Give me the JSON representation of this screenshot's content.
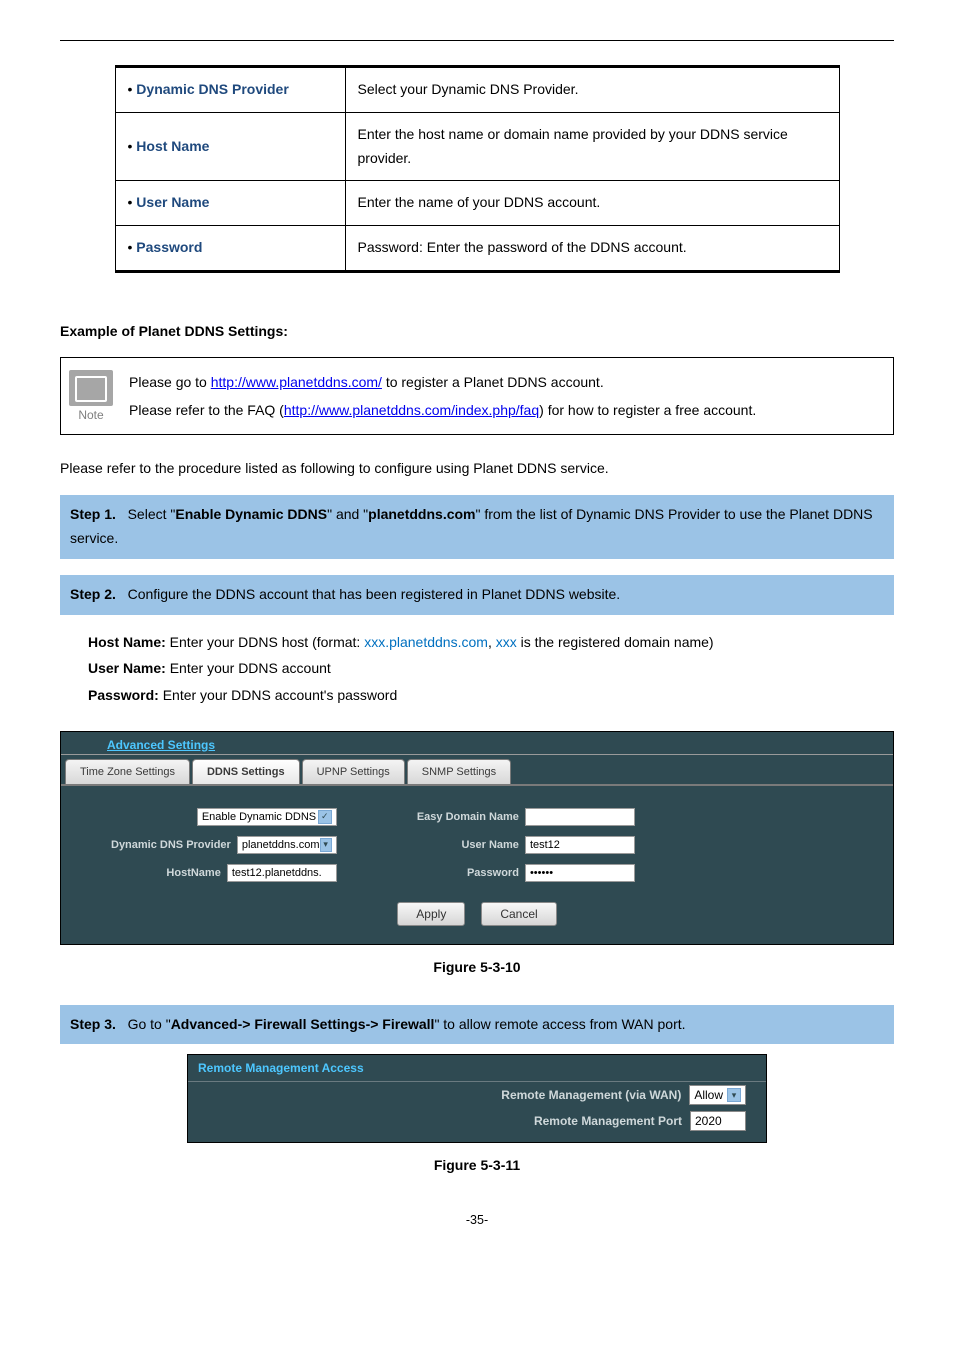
{
  "table": {
    "rows": [
      {
        "label": "Dynamic DNS Provider",
        "desc": "Select your Dynamic DNS Provider."
      },
      {
        "label": "Host Name",
        "desc": "Enter the host name or domain name provided by your DDNS service provider."
      },
      {
        "label": "User Name",
        "desc": "Enter the name of your DDNS account."
      },
      {
        "label": "Password",
        "desc": "Password: Enter the password of the DDNS account."
      }
    ]
  },
  "exampleHeading": "Example of Planet DDNS Settings:",
  "note": {
    "label": "Note",
    "line1_pre": "Please go to ",
    "link1": "http://www.planetddns.com/",
    "line1_post": " to register a Planet DDNS account.",
    "line2_pre": "Please refer to the FAQ (",
    "link2": "http://www.planetddns.com/index.php/faq",
    "line2_post": ") for how to register a free account."
  },
  "intro": "Please refer to the procedure listed as following to configure using Planet DDNS service.",
  "step1": {
    "label": "Step 1.",
    "t1": "Select \"",
    "s1": "Enable Dynamic DDNS",
    "t2": "\" and \"",
    "s2": "planetddns.com",
    "t3": "\" from the list of Dynamic DNS Provider to use the Planet DDNS service."
  },
  "step2": {
    "label": "Step 2.",
    "text": "Configure the DDNS account that has been registered in Planet DDNS website.",
    "body": {
      "hn_label": "Host Name:",
      "hn_text_pre": " Enter your DDNS host (format: ",
      "hn_fmt1": "xxx.planetddns.com",
      "hn_comma": ", ",
      "hn_fmt2": "xxx",
      "hn_text_post": " is the registered domain name)",
      "un_label": "User Name:",
      "un_text": " Enter your DDNS account",
      "pw_label": "Password:",
      "pw_text": " Enter your DDNS account's password"
    }
  },
  "ui1": {
    "header": "Advanced Settings",
    "tabs": [
      "Time Zone Settings",
      "DDNS Settings",
      "UPNP Settings",
      "SNMP Settings"
    ],
    "checkbox": "Enable Dynamic DDNS",
    "labels": {
      "provider": "Dynamic DNS Provider",
      "hostname": "HostName",
      "easyDomain": "Easy Domain Name",
      "userName": "User Name",
      "password": "Password"
    },
    "values": {
      "provider": "planetddns.com",
      "hostname": "test12.planetddns.",
      "easyDomain": "",
      "userName": "test12",
      "password": "••••••"
    },
    "buttons": {
      "apply": "Apply",
      "cancel": "Cancel"
    }
  },
  "fig1": "Figure 5-3-10",
  "step3": {
    "label": "Step 3.",
    "t1": "Go to \"",
    "s1": "Advanced-> Firewall Settings-> Firewall",
    "t2": "\" to allow remote access from WAN port."
  },
  "ui2": {
    "header": "Remote Management Access",
    "row1_label": "Remote Management (via WAN)",
    "row1_value": "Allow",
    "row2_label": "Remote Management Port",
    "row2_value": "2020"
  },
  "fig2": "Figure 5-3-11",
  "pageNum": "-35-"
}
